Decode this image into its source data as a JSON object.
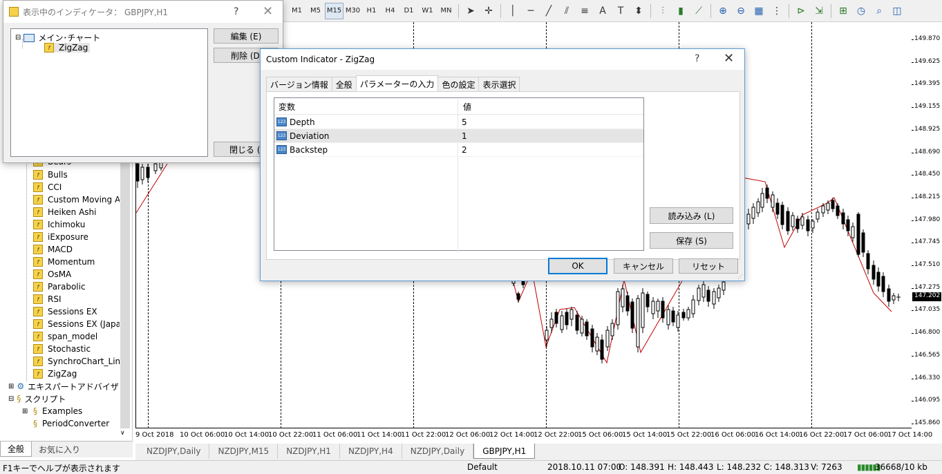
{
  "toolbar": {
    "timeframes": [
      "M1",
      "M5",
      "M15",
      "M30",
      "H1",
      "H4",
      "D1",
      "W1",
      "MN"
    ],
    "active_timeframe": "M15"
  },
  "navigator": {
    "items": [
      "Bulls",
      "CCI",
      "Custom Moving Av",
      "Heiken Ashi",
      "Ichimoku",
      "iExposure",
      "MACD",
      "Momentum",
      "OsMA",
      "Parabolic",
      "RSI",
      "Sessions EX",
      "Sessions EX (Japane",
      "span_model",
      "Stochastic",
      "SynchroChart_Line",
      "ZigZag"
    ],
    "partial_item": "Bears",
    "expert_advisors": "エキスパートアドバイザ",
    "scripts": "スクリプト",
    "script_items": [
      "Examples",
      "PeriodConverter"
    ],
    "tabs": [
      "全般",
      "お気に入り"
    ]
  },
  "indicators_window": {
    "title": "表示中のインディケータ： GBPJPY,H1",
    "help": "?",
    "close": "✕",
    "tree_root": "メイン･チャート",
    "tree_child": "ZigZag",
    "edit_button": "編集 (E)",
    "delete_button": "削除 (D)",
    "close_button": "閉じる (C)"
  },
  "custom_dialog": {
    "title": "Custom Indicator - ZigZag",
    "help": "?",
    "close": "✕",
    "tabs": [
      "バージョン情報",
      "全般",
      "パラメーターの入力",
      "色の設定",
      "表示選択"
    ],
    "active_tab": "パラメーターの入力",
    "col_variable": "変数",
    "col_value": "値",
    "params": [
      {
        "name": "Depth",
        "value": "5"
      },
      {
        "name": "Deviation",
        "value": "1"
      },
      {
        "name": "Backstep",
        "value": "2"
      }
    ],
    "load_button": "読み込み (L)",
    "save_button": "保存 (S)",
    "ok_button": "OK",
    "cancel_button": "キャンセル",
    "reset_button": "リセット"
  },
  "chart": {
    "y_ticks": [
      "149.870",
      "149.625",
      "149.395",
      "149.155",
      "148.925",
      "148.690",
      "148.450",
      "148.215",
      "147.980",
      "147.745",
      "147.510",
      "147.275",
      "147.035",
      "146.800",
      "146.565",
      "146.330",
      "146.095",
      "145.860"
    ],
    "current_price": "147.202",
    "x_ticks": [
      "9 Oct 2018",
      "10 Oct 06:00",
      "10 Oct 14:00",
      "10 Oct 22:00",
      "11 Oct 06:00",
      "11 Oct 14:00",
      "11 Oct 22:00",
      "12 Oct 06:00",
      "12 Oct 14:00",
      "12 Oct 22:00",
      "15 Oct 06:00",
      "15 Oct 14:00",
      "15 Oct 22:00",
      "16 Oct 06:00",
      "16 Oct 14:00",
      "16 Oct 22:00",
      "17 Oct 06:00",
      "17 Oct 14:00"
    ],
    "tabs": [
      "NZDJPY,Daily",
      "NZDJPY,M15",
      "NZDJPY,H1",
      "NZDJPY,H4",
      "NZDJPY,Daily",
      "GBPJPY,H1"
    ],
    "active_tab": "GBPJPY,H1"
  },
  "status": {
    "help": "F1キーでヘルプが表示されます",
    "profile": "Default",
    "datetime": "2018.10.11 07:00",
    "open": "O: 148.391",
    "high": "H: 148.443",
    "low": "L: 148.232",
    "close": "C: 148.313",
    "volume": "V: 7263",
    "traffic": "36668/10 kb"
  }
}
